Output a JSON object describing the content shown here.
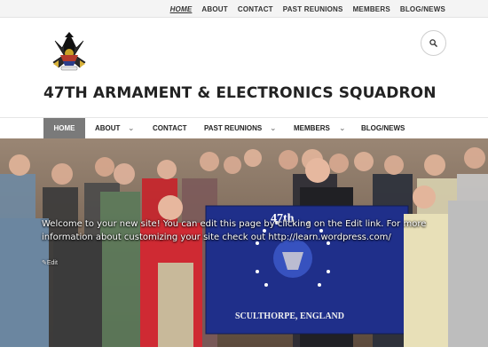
{
  "top_nav": {
    "items": [
      {
        "label": "HOME",
        "active": true
      },
      {
        "label": "ABOUT"
      },
      {
        "label": "CONTACT"
      },
      {
        "label": "PAST REUNIONS"
      },
      {
        "label": "MEMBERS"
      },
      {
        "label": "BLOG/NEWS"
      }
    ]
  },
  "header": {
    "logo": {
      "icon": "squadron-emblem-icon"
    },
    "site_title": "47TH ARMAMENT & ELECTRONICS SQUADRON",
    "search": {
      "icon": "search-icon"
    }
  },
  "main_nav": {
    "home": "HOME",
    "about": "ABOUT",
    "contact": "CONTACT",
    "past_reunions": "PAST REUNIONS",
    "members": "MEMBERS",
    "blog_news": "BLOG/NEWS",
    "chevron": "⌄"
  },
  "hero": {
    "welcome_text": "Welcome to your new site! You can edit this page by clicking on the Edit link. For more information about customizing your site check out ",
    "link_text": "http://learn.wordpress.com/",
    "edit_label": "Edit",
    "flag": {
      "number": "47th",
      "place": "SCULTHORPE, ENGLAND"
    }
  },
  "colors": {
    "accent_home_bg": "#7a7a7a",
    "flag_blue": "#1f2f8a",
    "text_dark": "#222222"
  }
}
